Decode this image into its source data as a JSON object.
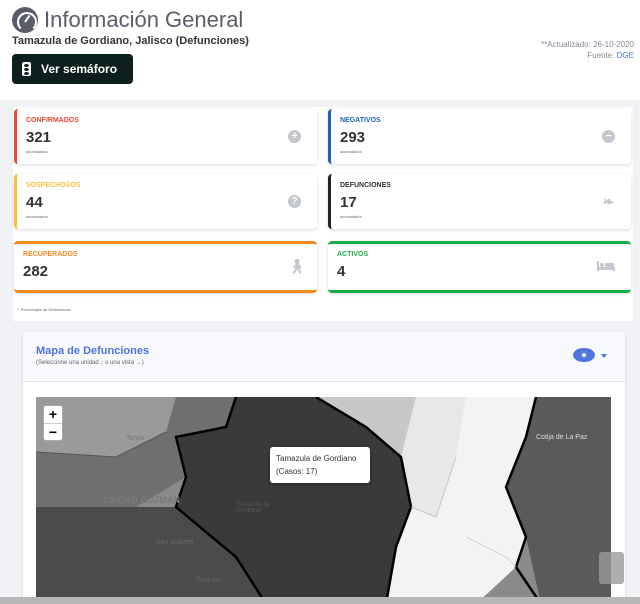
{
  "header": {
    "title": "Información General",
    "subtitle": "Tamazula de Gordiano, Jalisco (Defunciones)",
    "updated": "**Actualizado: 26-10-2020",
    "source_prefix": "Fuente: ",
    "source_link": "DGE",
    "semaforo_button": "Ver semáforo"
  },
  "cards": {
    "confirmados": {
      "label": "CONFIRMADOS",
      "value": "321",
      "sub": "acumulados",
      "color": "#e74a3b"
    },
    "negativos": {
      "label": "NEGATIVOS",
      "value": "293",
      "sub": "acumulados",
      "color": "#1f63b8"
    },
    "sospechosos": {
      "label": "SOSPECHOSOS",
      "value": "44",
      "sub": "acumulados",
      "color": "#f6c23e"
    },
    "defunciones": {
      "label": "DEFUNCIONES",
      "value": "17",
      "sub": "acumulados",
      "color": "#222222"
    },
    "recuperados": {
      "label": "RECUPERADOS",
      "value": "282",
      "color": "#f28b1e"
    },
    "activos": {
      "label": "ACTIVOS",
      "value": "4",
      "color": "#1cab4a"
    }
  },
  "footnote": "* Porcentajes de Defunciones",
  "map": {
    "title": "Mapa de Defunciones",
    "subtitle": "(Seleccione una unidad ↓ o una vista →)",
    "zoom_in": "+",
    "zoom_out": "−",
    "tooltip_name": "Tamazula de Gordiano",
    "tooltip_cases": "(Casos: 17)",
    "labels": {
      "cotija": "Cotija de La Paz",
      "ciudad_guzman": "CIUDAD GUZMAN",
      "san_gabriel": "San Gabriel",
      "tamazula": "Tamazula de Gordiano",
      "tuxpan": "Tuxpan",
      "tonila": "Tonila"
    }
  }
}
